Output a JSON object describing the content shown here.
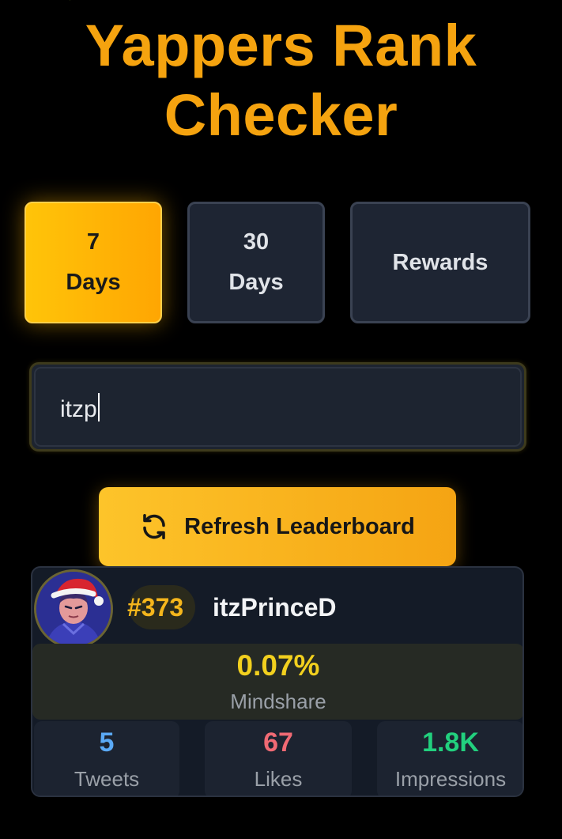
{
  "app": {
    "title": "Yappers Rank Checker"
  },
  "tabs": [
    {
      "label": "7\nDays",
      "active": true
    },
    {
      "label": "30\nDays",
      "active": false
    },
    {
      "label": "Rewards",
      "active": false
    }
  ],
  "search": {
    "value": "itzp"
  },
  "refresh": {
    "label": "Refresh Leaderboard",
    "icon": "refresh-icon"
  },
  "result": {
    "rank": "#373",
    "username": "itzPrinceD",
    "avatar_icon": "avatar-santa-hat",
    "mindshare": {
      "value": "0.07%",
      "label": "Mindshare"
    },
    "stats": [
      {
        "value": "5",
        "label": "Tweets",
        "color": "#5aa9f5"
      },
      {
        "value": "67",
        "label": "Likes",
        "color": "#f06a74"
      },
      {
        "value": "1.8K",
        "label": "Impressions",
        "color": "#22d07e"
      }
    ]
  },
  "colors": {
    "accent": "#f5a30f",
    "background": "#000000",
    "card": "#141b27",
    "mindshare": "#f2d01e"
  }
}
